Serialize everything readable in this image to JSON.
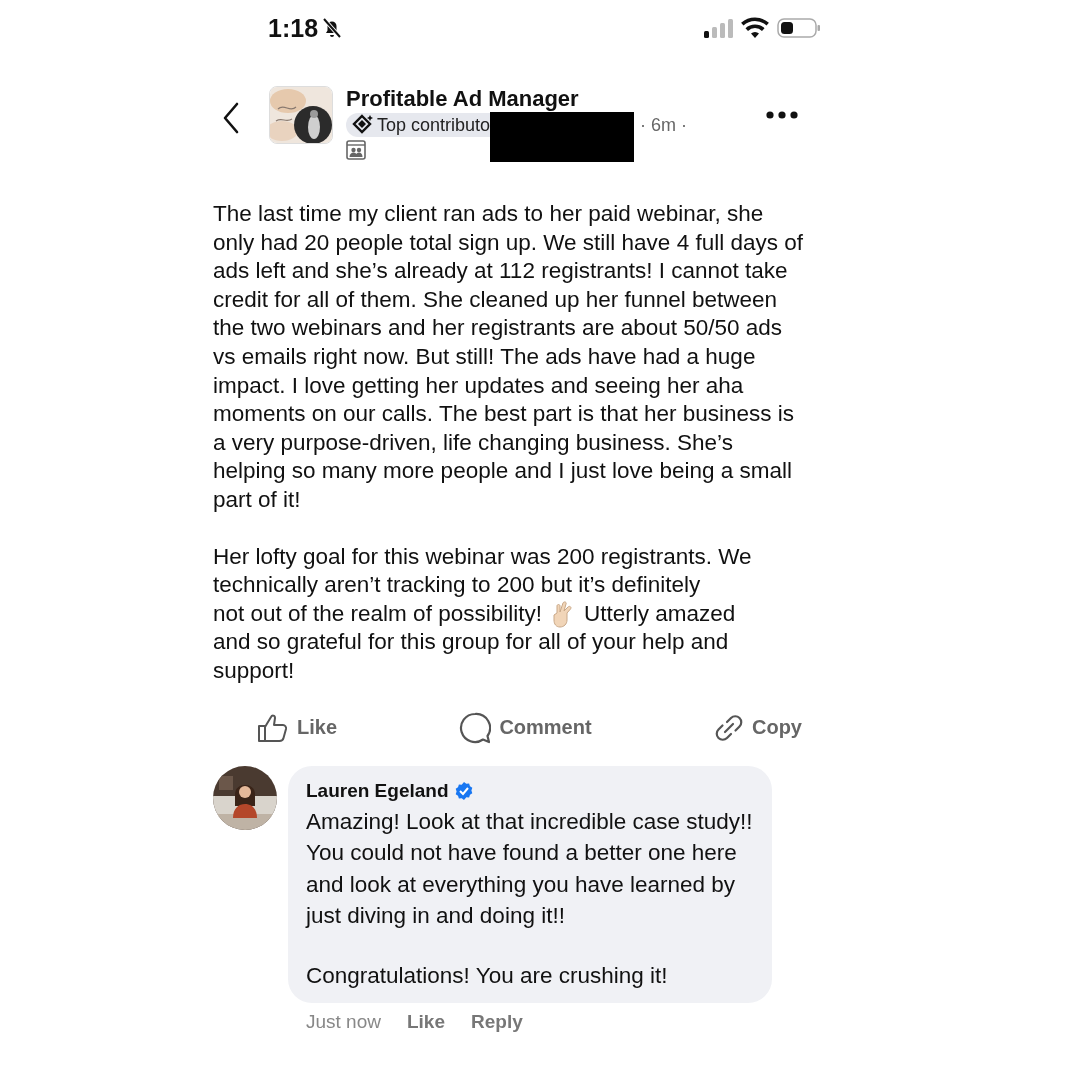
{
  "status_bar": {
    "time": "1:18",
    "silenced": true
  },
  "post": {
    "group": "Profitable Ad Manager",
    "badge": "Top contributo",
    "time": "· 6m ·",
    "paragraphs": [
      "The last time my client ran ads to her paid webinar, she only had 20 people total sign up. We still have 4 full days of ads left and she’s already at 112 registrants! I cannot take credit for all of them. She cleaned up her funnel between the two webinars and her registrants are about 50/50 ads vs emails right now. But still! The ads have had a huge impact. I love getting her updates and seeing her aha moments on our calls. The best part is that her business is a very purpose-driven, life changing business. She’s helping so many more people and I just love being a small part of it!"
    ],
    "closing": {
      "lead": "Her lofty goal for this webinar was 200 registrants. We technically aren’t tracking to 200 but it’s definitely",
      "before": "not out of the realm of possibility!",
      "after": "Utterly amazed",
      "rest": "and so grateful for this group for all of your help and support!"
    },
    "actions": [
      {
        "kind": "like",
        "label": "Like"
      },
      {
        "kind": "comment",
        "label": "Comment"
      },
      {
        "kind": "copy",
        "label": "Copy"
      }
    ]
  },
  "comment": {
    "author": "Lauren Egeland",
    "verified": true,
    "paragraphs": [
      "Amazing! Look at that incredible case study!! You could not have found a better one here and look at everything you have learned by just diving in and doing it!!",
      "Congratulations! You are crushing it!"
    ],
    "time": "Just now",
    "actions": [
      "Like",
      "Reply"
    ]
  }
}
